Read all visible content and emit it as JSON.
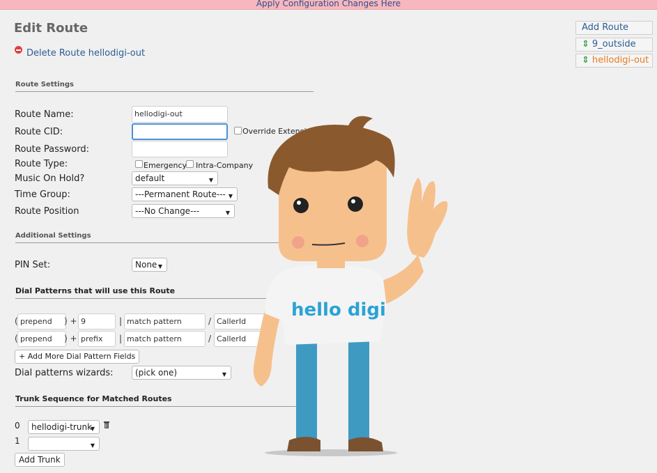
{
  "banner": {
    "apply_text": "Apply Configuration Changes Here"
  },
  "page": {
    "title": "Edit Route",
    "delete_link": "Delete Route hellodigi-out"
  },
  "sections": {
    "route_settings": "Route Settings",
    "additional_settings": "Additional Settings",
    "dial_patterns": "Dial Patterns that will use this Route",
    "trunk_sequence": "Trunk Sequence for Matched Routes"
  },
  "form": {
    "route_name_label": "Route Name:",
    "route_name_value": "hellodigi-out",
    "route_cid_label": "Route CID:",
    "route_cid_value": "",
    "override_extension_label": "Override Extension",
    "route_password_label": "Route Password:",
    "route_password_value": "",
    "route_type_label": "Route Type:",
    "emergency_label": "Emergency",
    "intra_company_label": "Intra-Company",
    "moh_label": "Music On Hold?",
    "moh_value": "default",
    "time_group_label": "Time Group:",
    "time_group_value": "---Permanent Route---",
    "route_position_label": "Route Position",
    "route_position_value": "---No Change---",
    "pin_set_label": "PIN Set:",
    "pin_set_value": "None"
  },
  "dial_patterns": {
    "rows": [
      {
        "prepend": "prepend",
        "prefix": "9",
        "match": "match pattern",
        "callerid": "CallerId"
      },
      {
        "prepend": "prepend",
        "prefix": "prefix",
        "match": "match pattern",
        "callerid": "CallerId"
      }
    ],
    "add_more_button": "+ Add More Dial Pattern Fields",
    "wizard_label": "Dial patterns wizards:",
    "wizard_value": "(pick one)",
    "open_paren": "(",
    "close_plus": ") +",
    "pipe_bracket": "| [",
    "slash": "/"
  },
  "trunks": {
    "rows": [
      {
        "index": "0",
        "value": "hellodigi-trunk"
      },
      {
        "index": "1",
        "value": ""
      }
    ],
    "add_button": "Add Trunk"
  },
  "right_nav": {
    "add_route": "Add Route",
    "routes": [
      {
        "label": "9_outside",
        "active": false
      },
      {
        "label": "hellodigi-out",
        "active": true
      }
    ]
  },
  "mascot": {
    "shirt_text": "hello digi"
  },
  "colors": {
    "banner_bg": "#f8b7be",
    "link": "#2b5d94",
    "active_route": "#e87b20",
    "mascot_shirt_text": "#2aa3d6"
  }
}
